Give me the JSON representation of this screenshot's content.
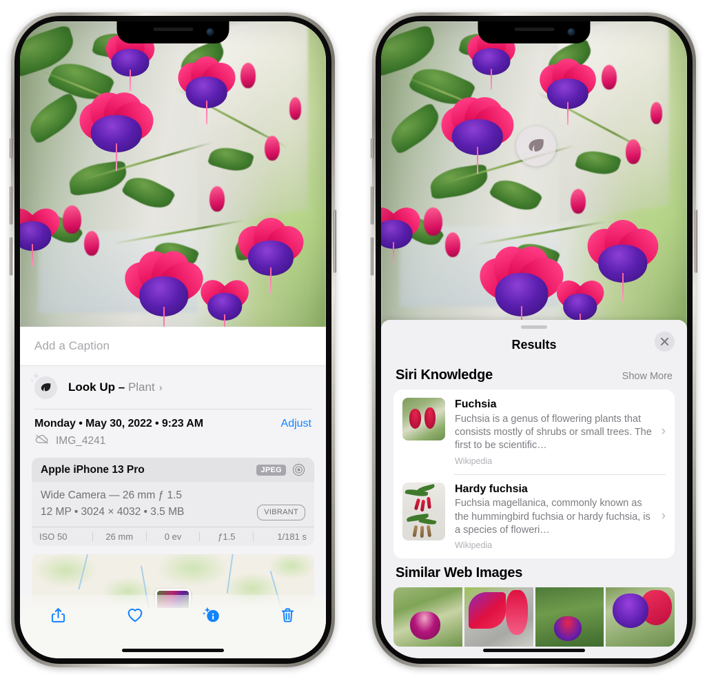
{
  "left_phone": {
    "photo_alt": "Hanging fuchsia plant with pink and purple flowers",
    "caption": {
      "placeholder": "Add a Caption",
      "value": ""
    },
    "lookup": {
      "label": "Look Up",
      "dash": "–",
      "subject": "Plant",
      "chevron": "›",
      "icon": "leaf-icon"
    },
    "info": {
      "date": "Monday • May 30, 2022 • 9:23 AM",
      "adjust_label": "Adjust",
      "filename": "IMG_4241",
      "cloud_icon": "icloud-slash-icon"
    },
    "exif": {
      "device": "Apple iPhone 13 Pro",
      "format_tag": "JPEG",
      "raw_icon": "raw-target-icon",
      "lens_line": "Wide Camera — 26 mm ƒ 1.5",
      "size_line": "12 MP • 3024 × 4032 • 3.5 MB",
      "style_tag": "VIBRANT",
      "stats": [
        "ISO 50",
        "26 mm",
        "0 ev",
        "ƒ1.5",
        "1/181 s"
      ]
    },
    "map": {
      "pin_label": "photo-thumbnail-pin"
    },
    "toolbar": [
      {
        "name": "share-button",
        "icon": "share-icon"
      },
      {
        "name": "favorite-button",
        "icon": "heart-icon"
      },
      {
        "name": "info-button",
        "icon": "info-sparkle-icon"
      },
      {
        "name": "delete-button",
        "icon": "trash-icon"
      }
    ]
  },
  "right_phone": {
    "photo_alt": "Hanging fuchsia plant with pink and purple flowers",
    "visual_lookup_pin": {
      "icon": "leaf-icon"
    },
    "sheet": {
      "title": "Results",
      "close_icon": "close-icon",
      "sections": [
        {
          "title": "Siri Knowledge",
          "action_label": "Show More",
          "items": [
            {
              "name": "Fuchsia",
              "description": "Fuchsia is a genus of flowering plants that consists mostly of shrubs or small trees. The first to be scientific…",
              "source": "Wikipedia",
              "chevron": "›"
            },
            {
              "name": "Hardy fuchsia",
              "description": "Fuchsia magellanica, commonly known as the hummingbird fuchsia or hardy fuchsia, is a species of floweri…",
              "source": "Wikipedia",
              "chevron": "›"
            }
          ]
        },
        {
          "title": "Similar Web Images",
          "thumbnails": [
            "fuchsia-web-image-1",
            "fuchsia-web-image-2",
            "fuchsia-web-image-3",
            "fuchsia-web-image-4"
          ]
        }
      ]
    }
  },
  "colors": {
    "accent_blue": "#1284ff",
    "sheet_bg": "#f1f1f4",
    "card_bg": "#ffffff",
    "secondary_text": "#7c7c82",
    "tertiary_text": "#b0b0b6"
  }
}
